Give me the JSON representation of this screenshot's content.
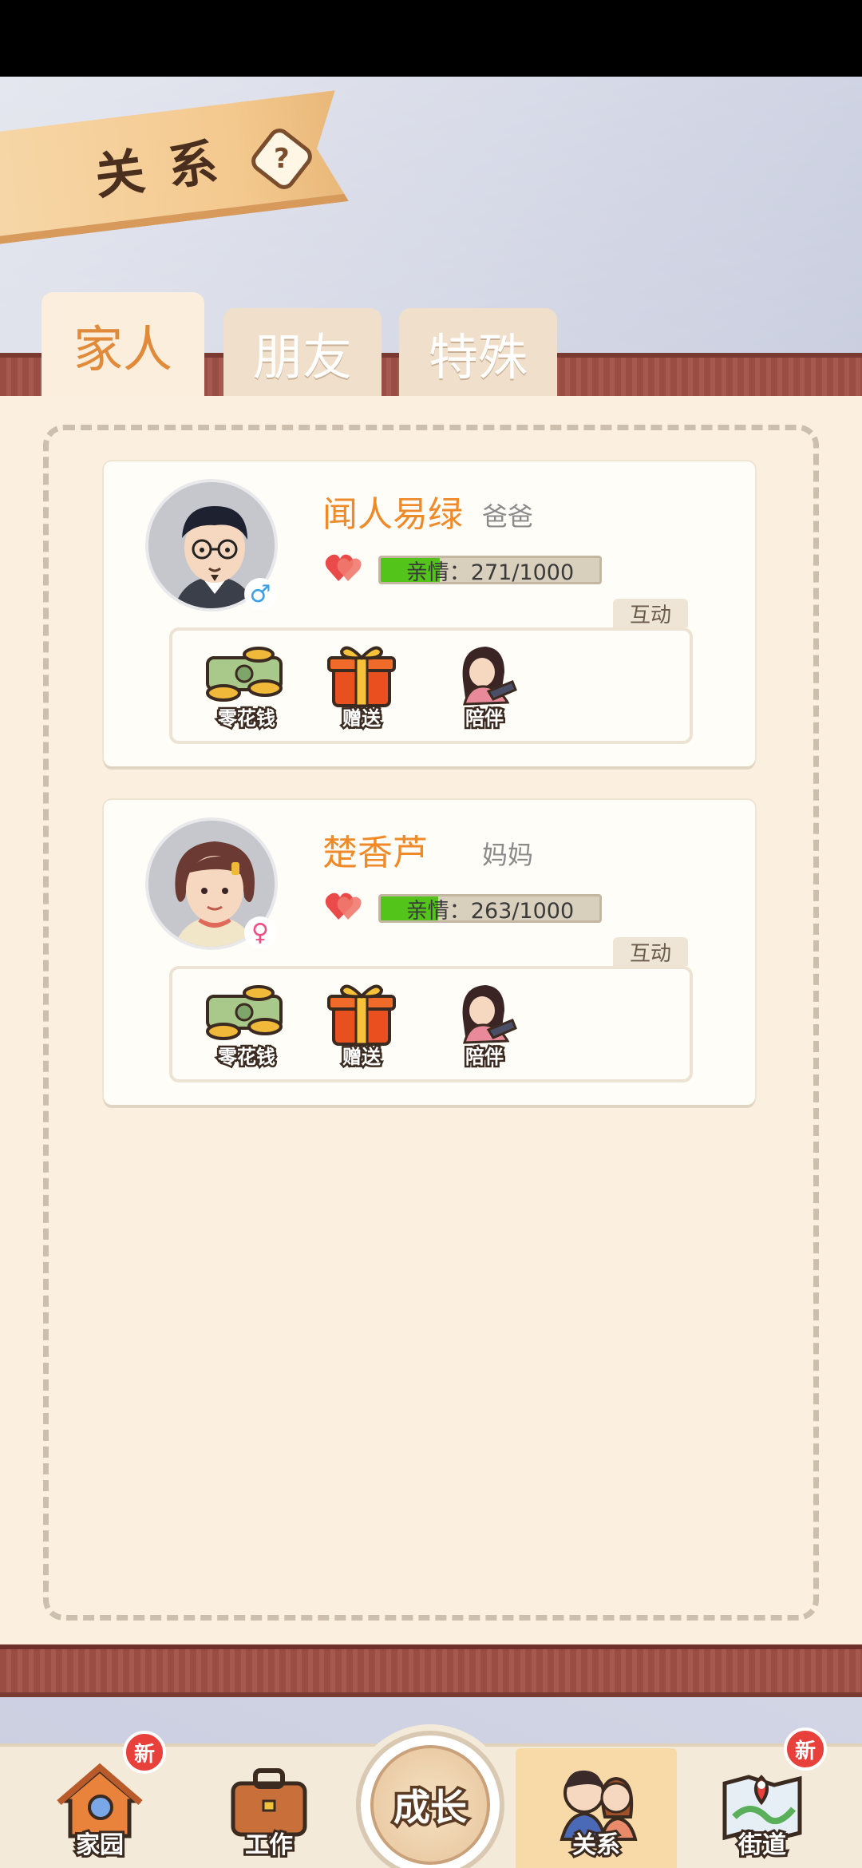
{
  "header": {
    "title": "关系",
    "help_glyph": "?"
  },
  "tabs": [
    {
      "label": "家人",
      "active": true
    },
    {
      "label": "朋友",
      "active": false
    },
    {
      "label": "特殊",
      "active": false
    }
  ],
  "members": [
    {
      "name": "闻人易绿",
      "relation": "爸爸",
      "gender_symbol": "♂",
      "affection_text": "亲情：271/1000",
      "affection_value": 271,
      "affection_max": 1000,
      "interact_label": "互动",
      "actions": [
        "零花钱",
        "赠送",
        "陪伴"
      ]
    },
    {
      "name": "楚香芦",
      "relation": "妈妈",
      "gender_symbol": "♀",
      "affection_text": "亲情：263/1000",
      "affection_value": 263,
      "affection_max": 1000,
      "interact_label": "互动",
      "actions": [
        "零花钱",
        "赠送",
        "陪伴"
      ]
    }
  ],
  "nav": {
    "home": "家园",
    "work": "工作",
    "grow": "成长",
    "relation": "关系",
    "street": "街道",
    "new_badge": "新"
  },
  "colors": {
    "accent_orange": "#ef8a2a",
    "bar_green": "#52c41a",
    "badge_red": "#e8413c",
    "wood": "#9a4d42"
  }
}
